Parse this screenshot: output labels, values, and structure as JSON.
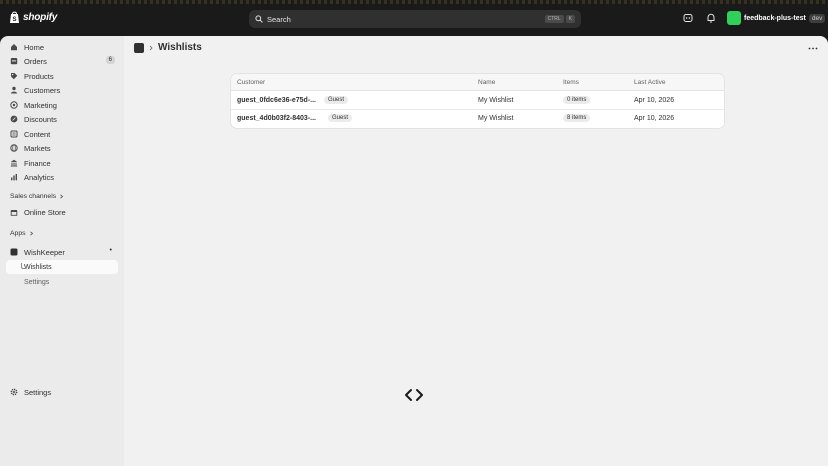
{
  "topbar": {
    "brand": "shopify",
    "search": {
      "placeholder": "Search",
      "shortcut_keys": [
        "CTRL",
        "K"
      ]
    },
    "store": {
      "name": "feedback-plus-test",
      "tag": "dev"
    }
  },
  "sidebar": {
    "items": [
      {
        "label": "Home",
        "icon": "home-icon"
      },
      {
        "label": "Orders",
        "icon": "orders-icon",
        "count": "6"
      },
      {
        "label": "Products",
        "icon": "tag-icon"
      },
      {
        "label": "Customers",
        "icon": "person-icon"
      },
      {
        "label": "Marketing",
        "icon": "target-icon"
      },
      {
        "label": "Discounts",
        "icon": "discount-icon"
      },
      {
        "label": "Content",
        "icon": "content-icon"
      },
      {
        "label": "Markets",
        "icon": "globe-icon"
      },
      {
        "label": "Finance",
        "icon": "bank-icon"
      },
      {
        "label": "Analytics",
        "icon": "chart-icon"
      }
    ],
    "sales_channels": {
      "heading": "Sales channels",
      "items": [
        {
          "label": "Online Store",
          "icon": "store-icon"
        }
      ]
    },
    "apps": {
      "heading": "Apps",
      "app": {
        "label": "WishKeeper",
        "indicator": "•"
      },
      "sub_items": [
        {
          "label": "Wishlists",
          "active": true
        },
        {
          "label": "Settings"
        }
      ]
    },
    "settings": {
      "label": "Settings",
      "icon": "gear-icon"
    }
  },
  "page": {
    "title": "Wishlists",
    "table": {
      "columns": [
        "Customer",
        "Name",
        "Items",
        "Last Active"
      ],
      "rows": [
        {
          "customer": "guest_0fdc6e36-e75d-...",
          "badge": "Guest",
          "name": "My Wishlist",
          "items": "0 items",
          "last_active": "Apr 10, 2026"
        },
        {
          "customer": "guest_4d0b03f2-8403-...",
          "badge": "Guest",
          "name": "My Wishlist",
          "items": "8 items",
          "last_active": "Apr 10, 2026"
        }
      ]
    }
  },
  "colors": {
    "topbar": "#1a1a1a",
    "sidebar": "#ebebeb",
    "main": "#f1f1f1",
    "store_avatar": "#2fd15a"
  }
}
